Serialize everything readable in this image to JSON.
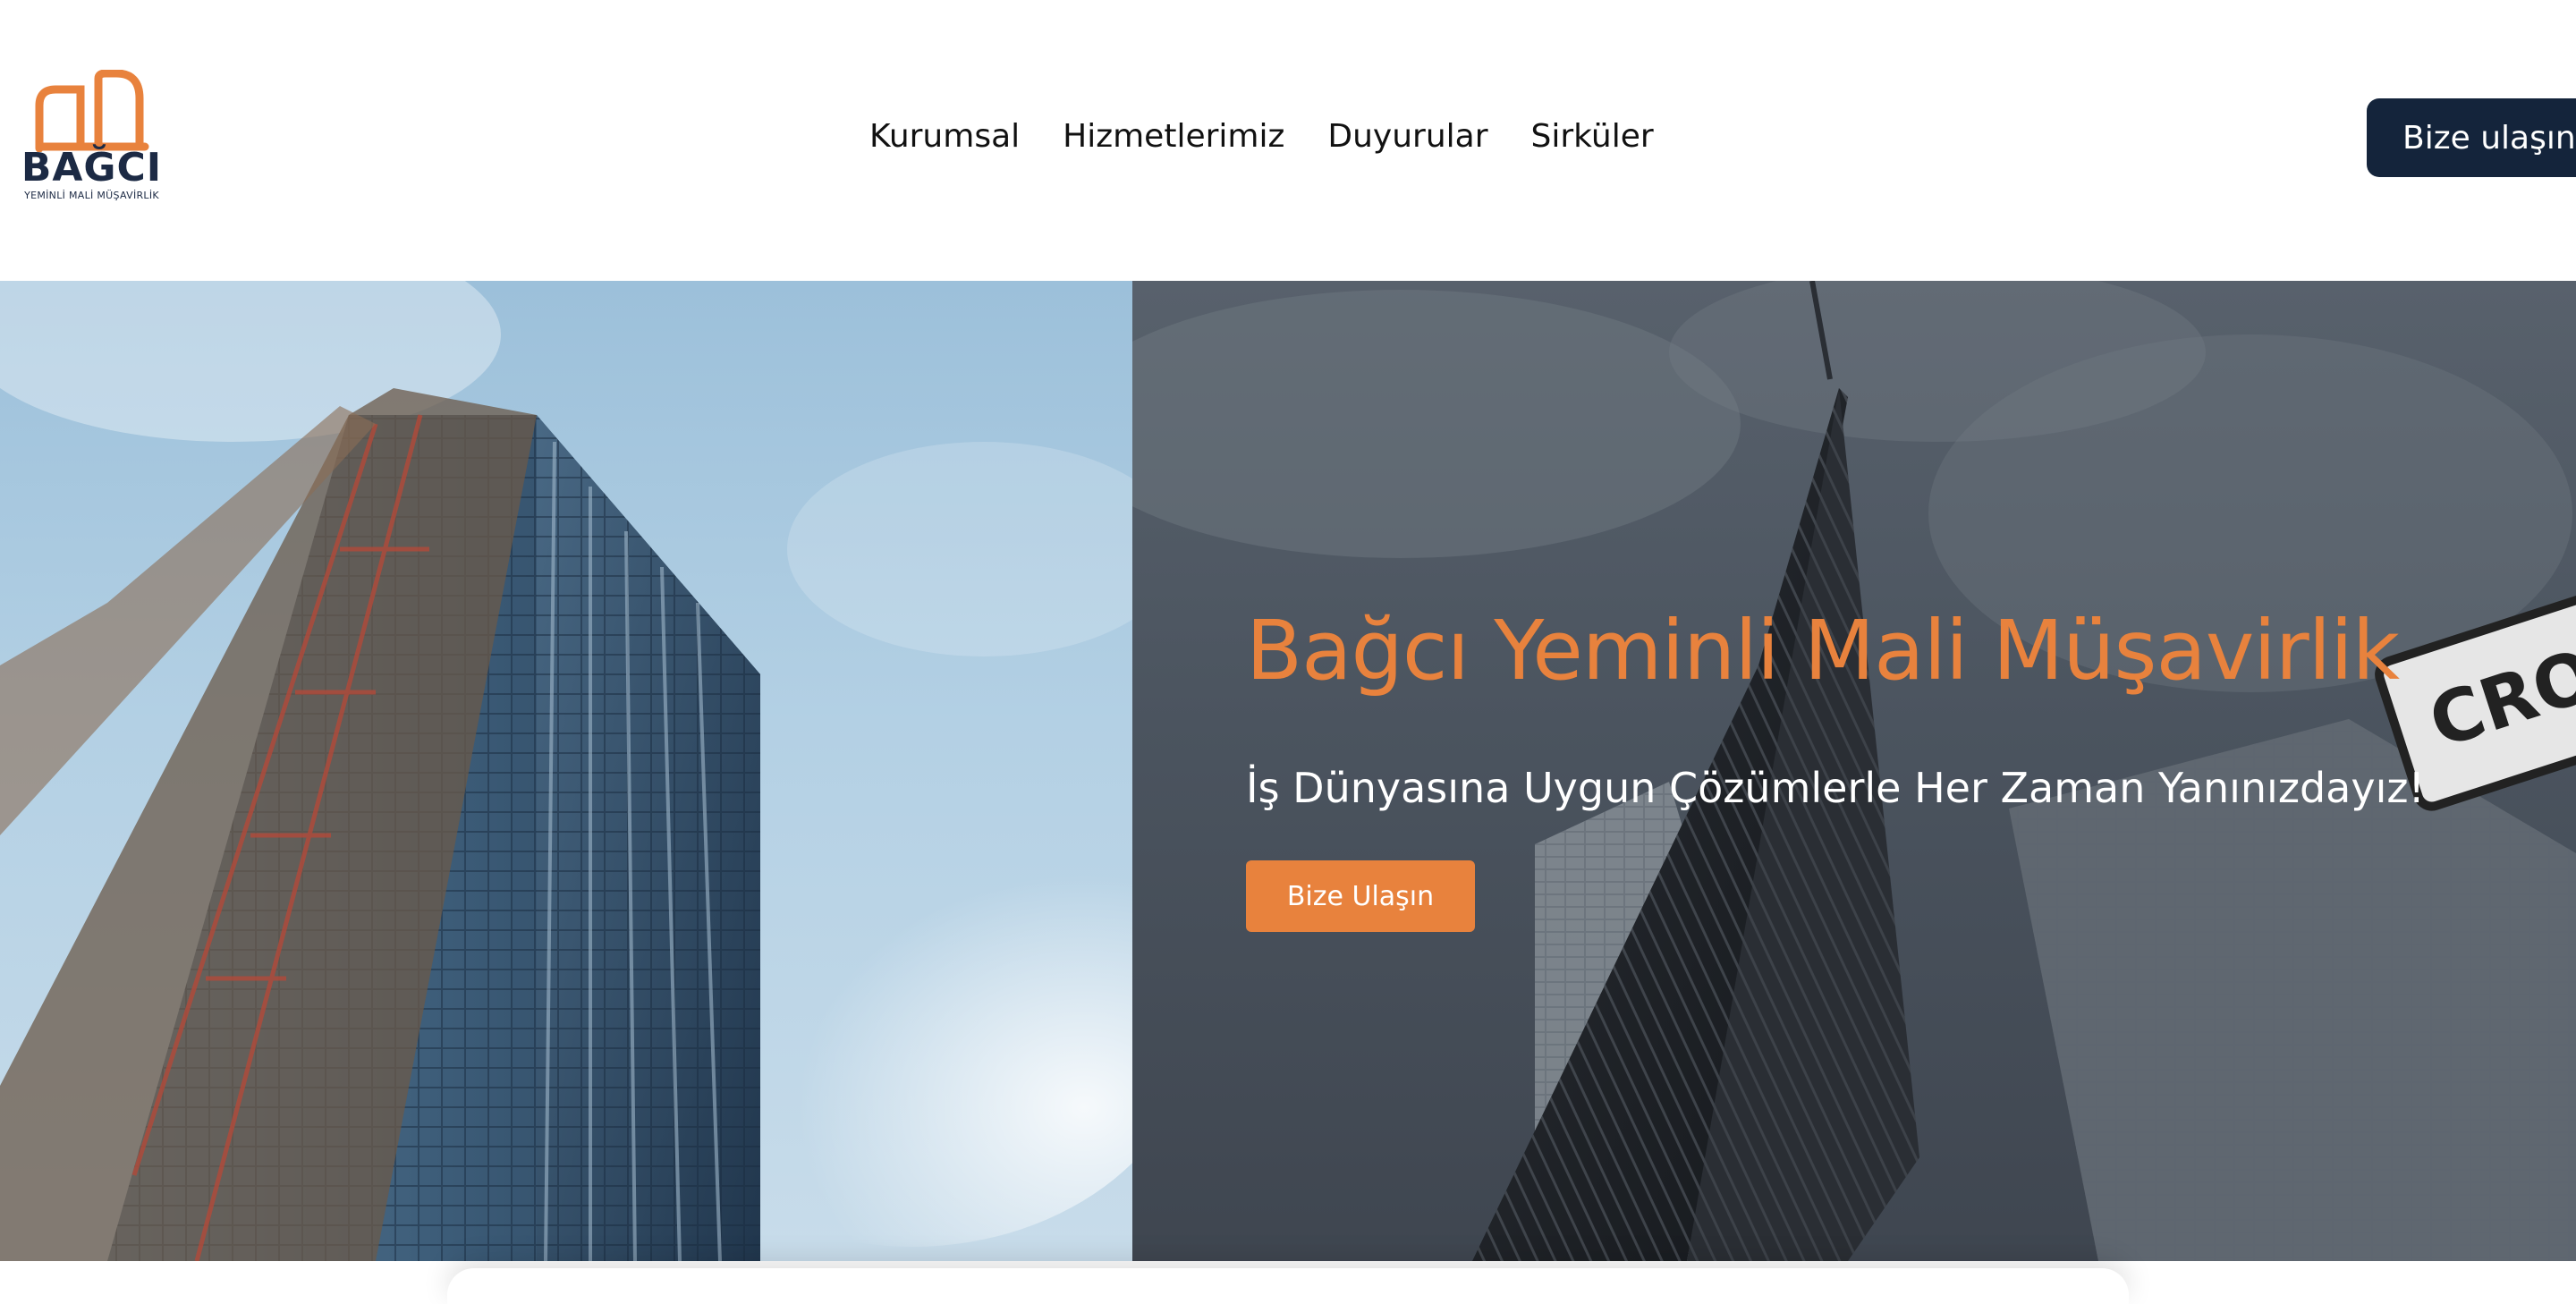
{
  "brand": {
    "name": "BAĞCI",
    "tagline": "YEMİNLİ MALİ MÜŞAVİRLİK",
    "accent_color": "#e8823d",
    "dark_color": "#14243b"
  },
  "nav": {
    "items": [
      {
        "label": "Kurumsal"
      },
      {
        "label": "Hizmetlerimiz"
      },
      {
        "label": "Duyurular"
      },
      {
        "label": "Sirküler"
      }
    ]
  },
  "header": {
    "cta_label": "Bize ulaşın"
  },
  "hero": {
    "title": "Bağcı Yeminli Mali Müşavirlik",
    "subtitle": "İş Dünyasına Uygun Çözümlerle Her Zaman Yanınızdayız!",
    "cta_label": "Bize Ulaşın",
    "sign_text": "CRO"
  }
}
